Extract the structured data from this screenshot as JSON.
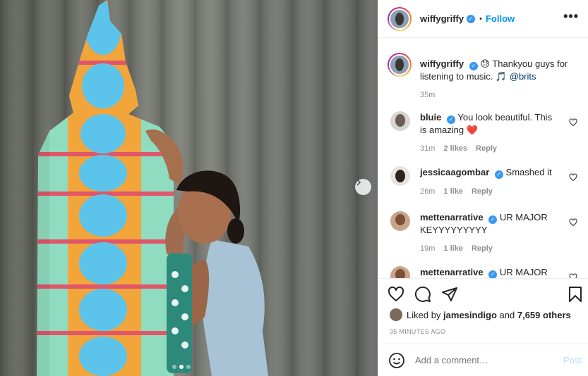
{
  "header": {
    "username": "wiffygriffy",
    "bullet": "•",
    "follow_label": "Follow",
    "more_label": "•••"
  },
  "caption": {
    "username": "wiffygriffy",
    "text": "😓 Thankyou guys for listening to music. 🎵",
    "mention": "@brits",
    "time": "35m"
  },
  "comments": [
    {
      "username": "bluie",
      "verified": true,
      "text": "You look beautiful. This is amazing",
      "emoji": "❤️",
      "time": "31m",
      "likes": "2 likes",
      "reply": "Reply"
    },
    {
      "username": "jessicaagombar",
      "verified": true,
      "text": "Smashed it",
      "emoji": "",
      "time": "26m",
      "likes": "1 like",
      "reply": "Reply"
    },
    {
      "username": "mettenarrative",
      "verified": true,
      "text": "UR MAJOR KEYYYYYYYYY",
      "emoji": "",
      "time": "19m",
      "likes": "1 like",
      "reply": "Reply"
    },
    {
      "username": "mettenarrative",
      "verified": true,
      "text": "UR MAJOR",
      "emoji": "",
      "time": "",
      "likes": "",
      "reply": ""
    }
  ],
  "likes": {
    "prefix": "Liked by",
    "user": "jamesindigo",
    "joiner": "and",
    "others": "7,659 others"
  },
  "timestamp": "35 MINUTES AGO",
  "add_comment": {
    "placeholder": "Add a comment…",
    "post_label": "Post"
  },
  "icons": {
    "like": "heart-icon",
    "comment": "comment-icon",
    "share": "paper-plane-icon",
    "save": "bookmark-icon",
    "emoji": "smiley-icon",
    "next": "chevron-right-icon",
    "verified": "verified-badge-icon"
  },
  "colors": {
    "link": "#0095f6",
    "verified": "#3897f0",
    "muted": "#8e8e8e",
    "post_disabled": "#b2dffc",
    "text": "#262626"
  },
  "carousel": {
    "slides": 3,
    "active": 1
  }
}
